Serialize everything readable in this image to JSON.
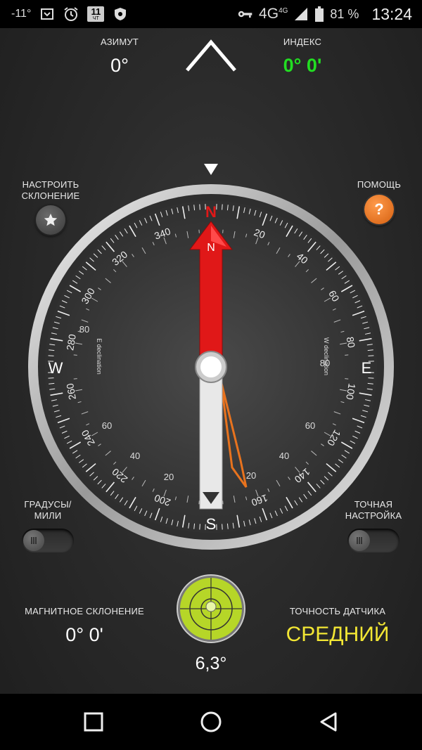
{
  "status_bar": {
    "temperature": "-11°",
    "network": "4G",
    "network_small": "4G",
    "battery": "81 %",
    "time": "13:24",
    "icons": [
      "download-box-icon",
      "alarm-icon",
      "calendar-11-icon",
      "shield-icon",
      "key-icon",
      "signal-icon",
      "battery-icon"
    ],
    "calendar_day": "11",
    "calendar_sub": "ЧТ"
  },
  "azimuth": {
    "label": "АЗИМУТ",
    "value": "0°"
  },
  "index": {
    "label": "ИНДЕКС",
    "value": "0° 0'",
    "color": "#22dd22"
  },
  "declination_button": {
    "label_line1": "НАСТРОИТЬ",
    "label_line2": "СКЛОНЕНИЕ"
  },
  "help_button": {
    "label": "ПОМОЩЬ",
    "glyph": "?",
    "color": "#e8731e"
  },
  "compass": {
    "cardinals": {
      "n": "N",
      "e": "E",
      "s": "S",
      "w": "W"
    },
    "needle_letter": "N",
    "outer_labels": [
      "20",
      "40",
      "60",
      "80",
      "100",
      "120",
      "140",
      "160",
      "200",
      "220",
      "240",
      "260",
      "280",
      "300",
      "320",
      "340"
    ],
    "inner_labels": [
      "80",
      "60",
      "40",
      "20",
      "20",
      "40",
      "60",
      "80"
    ],
    "e_declination": "E declination",
    "w_declination": "W declination",
    "needle_color": "#e01818"
  },
  "units_toggle": {
    "label_line1": "ГРАДУСЫ/",
    "label_line2": "МИЛИ"
  },
  "fine_toggle": {
    "label_line1": "ТОЧНАЯ",
    "label_line2": "НАСТРОЙКА"
  },
  "magnetic_declination": {
    "label": "МАГНИТНОЕ СКЛОНЕНИЕ",
    "value": "0° 0'"
  },
  "sensor_accuracy": {
    "label": "ТОЧНОСТЬ ДАТЧИКА",
    "value": "СРЕДНИЙ",
    "color": "#f2e634"
  },
  "level": {
    "value": "6,3°",
    "color": "#b6d628"
  },
  "nav": {
    "icons": [
      "square-icon",
      "circle-icon",
      "back-triangle-icon"
    ]
  }
}
